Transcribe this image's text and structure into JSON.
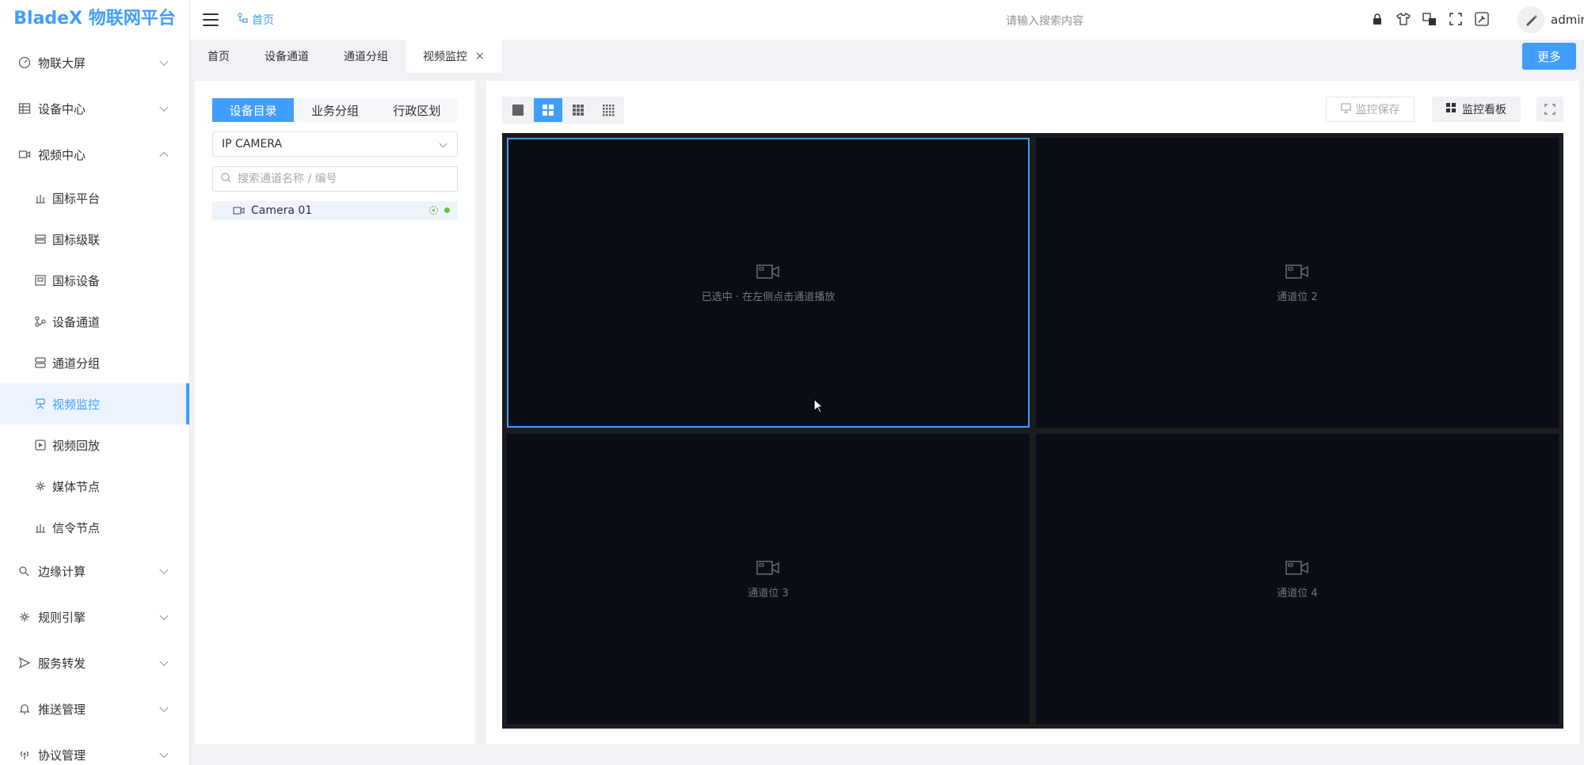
{
  "app": {
    "title": "BladeX 物联网平台"
  },
  "sidebar": {
    "groups": [
      {
        "label": "物联大屏",
        "icon": "dashboard-icon"
      },
      {
        "label": "设备中心",
        "icon": "device-icon"
      },
      {
        "label": "视频中心",
        "icon": "video-icon",
        "expanded": true
      }
    ],
    "video_children": [
      {
        "label": "国标平台",
        "icon": "platform-icon"
      },
      {
        "label": "国标级联",
        "icon": "cascade-icon"
      },
      {
        "label": "国标设备",
        "icon": "device-icon"
      },
      {
        "label": "设备通道",
        "icon": "channel-icon"
      },
      {
        "label": "通道分组",
        "icon": "group-icon"
      },
      {
        "label": "视频监控",
        "icon": "monitor-icon",
        "active": true
      },
      {
        "label": "视频回放",
        "icon": "playback-icon"
      },
      {
        "label": "媒体节点",
        "icon": "media-node-icon"
      },
      {
        "label": "信令节点",
        "icon": "signal-node-icon"
      }
    ],
    "bottom_groups": [
      {
        "label": "边缘计算",
        "icon": "edge-icon"
      },
      {
        "label": "规则引擎",
        "icon": "rule-icon"
      },
      {
        "label": "服务转发",
        "icon": "forward-icon"
      },
      {
        "label": "推送管理",
        "icon": "bell-icon"
      },
      {
        "label": "协议管理",
        "icon": "protocol-icon"
      }
    ]
  },
  "header": {
    "breadcrumb": "首页",
    "search_placeholder": "请输入搜索内容",
    "user": "admin",
    "icons": [
      "lock-icon",
      "theme-icon",
      "language-icon",
      "fullscreen-icon",
      "settings-icon"
    ]
  },
  "tabs": {
    "items": [
      "首页",
      "设备通道",
      "通道分组",
      "视频监控"
    ],
    "active": "视频监控",
    "more_label": "更多"
  },
  "left_panel": {
    "segments": [
      "设备目录",
      "业务分组",
      "行政区划"
    ],
    "active_segment": "设备目录",
    "selected_device": "IP CAMERA",
    "search_placeholder": "搜索通道名称 / 编号",
    "tree": [
      {
        "label": "Camera 01",
        "status": "online"
      }
    ]
  },
  "right_panel": {
    "save_label": "监控保存",
    "board_label": "监控看板",
    "active_layout": 2,
    "cells": [
      {
        "label": "已选中 · 在左侧点击通道播放",
        "selected": true
      },
      {
        "label": "通道位 2"
      },
      {
        "label": "通道位 3"
      },
      {
        "label": "通道位 4"
      }
    ]
  },
  "colors": {
    "accent": "#409eff",
    "online": "#67c23a",
    "video_bg": "#090d16"
  }
}
